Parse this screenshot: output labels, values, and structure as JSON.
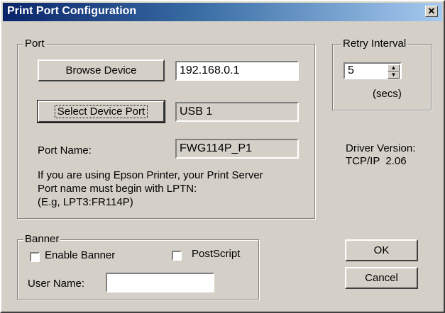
{
  "window": {
    "title": "Print Port Configuration",
    "close_glyph": "✕"
  },
  "port": {
    "legend": "Port",
    "browse_label": "Browse Device",
    "ip_value": "192.168.0.1",
    "select_port_label": "Select Device Port",
    "device_port_value": "USB 1",
    "port_name_label": "Port Name:",
    "port_name_value": "FWG114P_P1",
    "note_line1": "If you are using Epson Printer, your Print Server",
    "note_line2": "Port name must begin with LPTN:",
    "note_line3": "(E.g, LPT3:FR114P)"
  },
  "retry": {
    "legend": "Retry Interval",
    "value": "5",
    "unit": "(secs)",
    "up_glyph": "▲",
    "down_glyph": "▼"
  },
  "driver": {
    "version_label": "Driver Version:",
    "version_value": "TCP/IP  2.06"
  },
  "banner": {
    "legend": "Banner",
    "enable_label": "Enable Banner",
    "enable_checked": false,
    "postscript_label": "PostScript",
    "postscript_checked": false,
    "user_name_label": "User Name:",
    "user_name_value": ""
  },
  "buttons": {
    "ok_label": "OK",
    "cancel_label": "Cancel"
  }
}
